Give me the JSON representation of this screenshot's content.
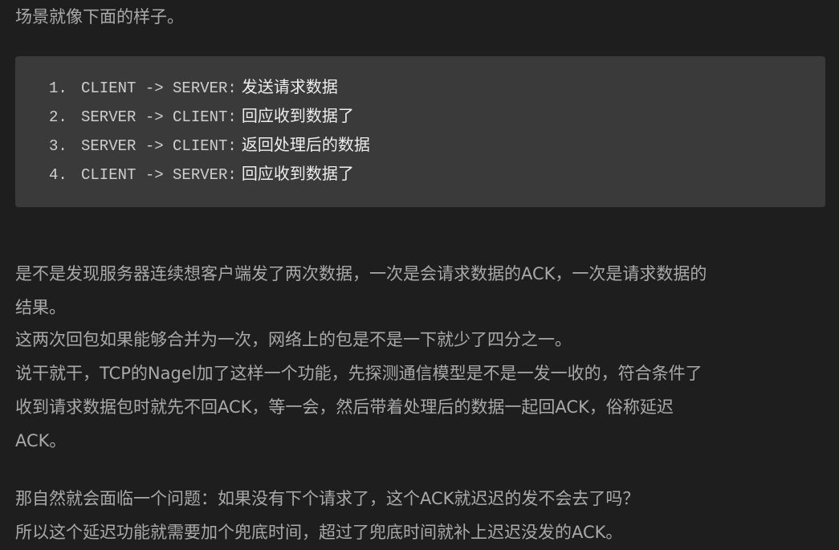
{
  "intro": "场景就像下面的样子。",
  "code_lines": [
    {
      "num": "1.",
      "code": "CLIENT -> SERVER:",
      "text": "发送请求数据"
    },
    {
      "num": "2.",
      "code": "SERVER -> CLIENT:",
      "text": "回应收到数据了"
    },
    {
      "num": "3.",
      "code": "SERVER -> CLIENT:",
      "text": "返回处理后的数据"
    },
    {
      "num": "4.",
      "code": "CLIENT -> SERVER:",
      "text": "回应收到数据了"
    }
  ],
  "paragraphs": {
    "p1_line1": "是不是发现服务器连续想客户端发了两次数据，一次是会请求数据的ACK，一次是请求数据的",
    "p1_line2": "结果。",
    "p2": "这两次回包如果能够合并为一次，网络上的包是不是一下就少了四分之一。",
    "p3_line1": "说干就干，TCP的Nagel加了这样一个功能，先探测通信模型是不是一发一收的，符合条件了",
    "p3_line2": "收到请求数据包时就先不回ACK，等一会，然后带着处理后的数据一起回ACK，俗称延迟",
    "p3_line3": "ACK。",
    "p4": "那自然就会面临一个问题：如果没有下个请求了，这个ACK就迟迟的发不会去了吗？",
    "p5": "所以这个延迟功能就需要加个兜底时间，超过了兜底时间就补上迟迟没发的ACK。"
  }
}
